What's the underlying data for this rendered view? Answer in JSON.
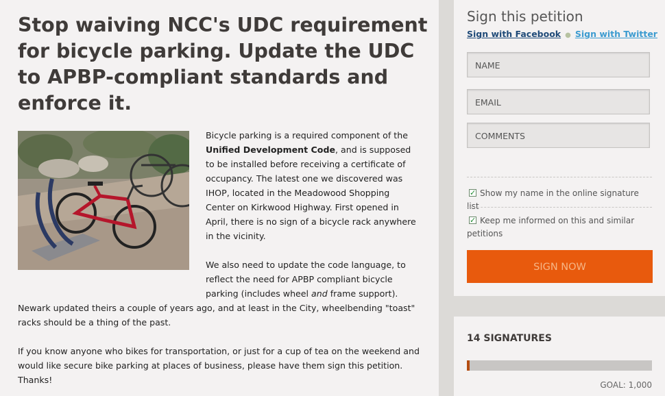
{
  "main": {
    "title": "Stop waiving NCC's UDC requirement for bicycle parking. Update the UDC to APBP-compliant standards and enforce it.",
    "paragraphs": {
      "p1_before": "Bicycle parking is a required component of the ",
      "p1_bold": "Unified Development Code",
      "p1_after": ", and is supposed to be installed before receiving a certificate of occupancy. The latest one we discovered was IHOP, located in the Meadowood Shopping Center on Kirkwood Highway. First opened in April, there is no sign of a bicycle rack anywhere in the vicinity.",
      "p2_right": "We also need to update the code language, to reflect the need for APBP compliant bicycle parking (includes wheel ",
      "p2_italic": "and",
      "p2_right_after": " frame support).",
      "p2_full": "Newark updated theirs a couple of years ago, and at least in the City, wheelbending \"toast\" racks should be a thing of the past.",
      "p3": "If you know anyone who bikes for transportation, or just for a cup of tea on the weekend and would like secure bike parking at places of business, please have them sign this petition. Thanks!"
    }
  },
  "sidebar": {
    "title": "Sign this petition",
    "facebook_link": "Sign with Facebook",
    "twitter_link": "Sign with Twitter",
    "fields": {
      "name_placeholder": "NAME",
      "email_placeholder": "EMAIL",
      "comments_placeholder": "COMMENTS"
    },
    "checkboxes": {
      "show_name": "Show my name in the online signature list",
      "keep_informed": "Keep me informed on this and similar petitions"
    },
    "sign_button": "SIGN NOW"
  },
  "signatures": {
    "count_label": "14 SIGNATURES",
    "goal_label": "GOAL: 1,000",
    "progress_fraction": 0.014
  },
  "colors": {
    "accent": "#e85a0d",
    "facebook": "#1f4a78",
    "twitter": "#3b9bd0"
  }
}
